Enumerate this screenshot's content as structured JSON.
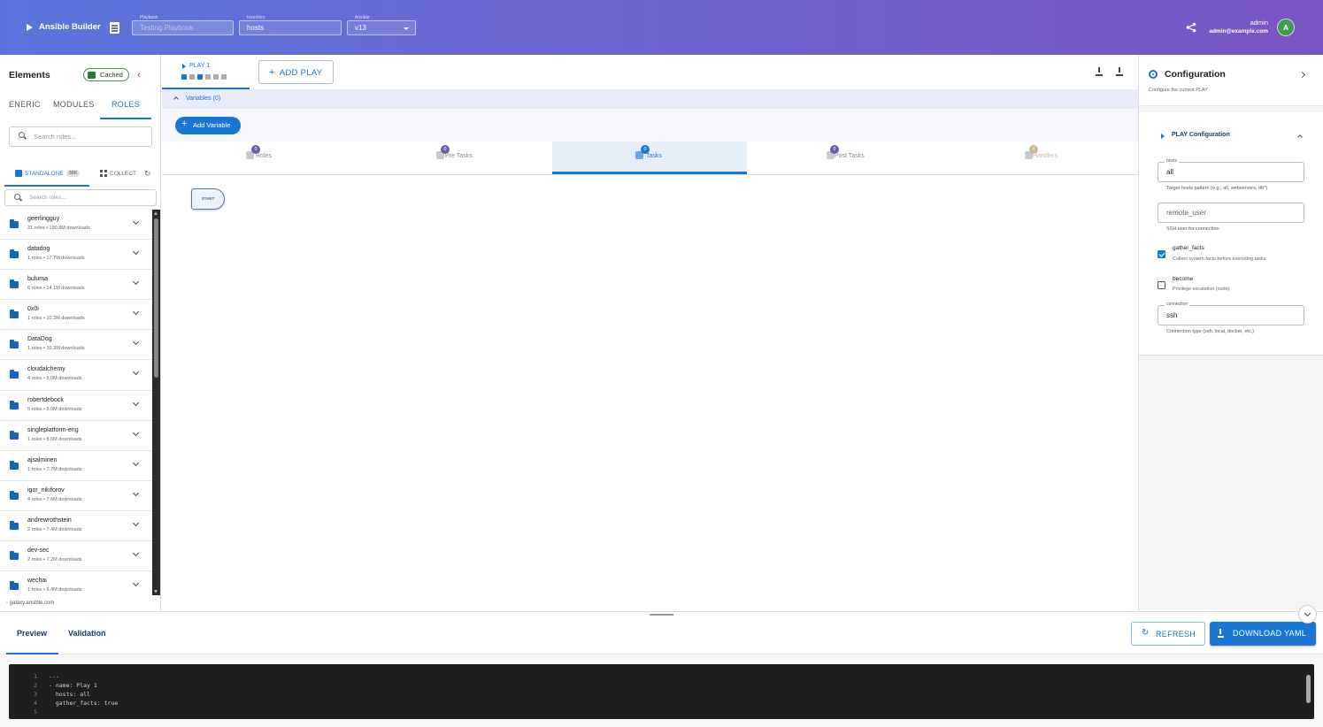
{
  "header": {
    "app_title": "Ansible Builder",
    "playbook_field": {
      "label": "Playbook",
      "value": "Testing Playbook"
    },
    "inventory_field": {
      "label": "Inventory",
      "value": "hosts"
    },
    "ansible_field": {
      "label": "Ansible",
      "value": "v13"
    },
    "user_name": "admin",
    "user_email": "admin@example.com",
    "avatar_initial": "A"
  },
  "sidebar": {
    "title": "Elements",
    "cached_label": "Cached",
    "tabs": [
      "ENERIC",
      "MODULES",
      "ROLES"
    ],
    "search_placeholder": "Search roles...",
    "subtabs": {
      "standalone": "STANDALONE",
      "standalone_badge": "38K",
      "collections": "COLLECT"
    },
    "search2_placeholder": "Search roles...",
    "roles": [
      {
        "name": "geerlingguy",
        "meta": "31 roles • 190.8M downloads"
      },
      {
        "name": "datadog",
        "meta": "1 roles • 17.7M downloads"
      },
      {
        "name": "buluma",
        "meta": "6 roles • 14.1M downloads"
      },
      {
        "name": "0x0i",
        "meta": "1 roles • 10.3M downloads"
      },
      {
        "name": "DataDog",
        "meta": "1 roles • 10.3M downloads"
      },
      {
        "name": "cloudalchemy",
        "meta": "4 roles • 8.0M downloads"
      },
      {
        "name": "robertdebock",
        "meta": "5 roles • 8.0M downloads"
      },
      {
        "name": "singleplatform-eng",
        "meta": "1 roles • 8.6M downloads"
      },
      {
        "name": "ajsalminen",
        "meta": "1 roles • 7.7M downloads"
      },
      {
        "name": "igor_nikiforov",
        "meta": "4 roles • 7.6M downloads"
      },
      {
        "name": "andrewrothstein",
        "meta": "2 roles • 7.4M downloads"
      },
      {
        "name": "dev-sec",
        "meta": "2 roles • 7.2M downloads"
      },
      {
        "name": "wechai",
        "meta": "1 roles • 6.4M downloads"
      }
    ],
    "footer": "galaxy.ansible.com"
  },
  "center": {
    "play_tab_label": "PLAY 1",
    "add_play_label": "ADD PLAY",
    "variables_label": "Variables (0)",
    "add_variable_label": "Add Variable",
    "section_tabs": [
      {
        "label": "Roles",
        "count": "0"
      },
      {
        "label": "Pre Tasks",
        "count": "0"
      },
      {
        "label": "Tasks",
        "count": "0"
      },
      {
        "label": "Post Tasks",
        "count": "0"
      },
      {
        "label": "Handlers",
        "count": "0"
      }
    ],
    "start_node_label": "START"
  },
  "config": {
    "title": "Configuration",
    "subtitle": "Configure the current PLAY",
    "section_title": "PLAY Configuration",
    "hosts_label": "hosts",
    "hosts_value": "all",
    "hosts_help": "Target hosts pattern (e.g., all, webservers, db*)",
    "remote_user_placeholder": "remote_user",
    "remote_user_help": "SSH user for connection",
    "gather_facts_label": "gather_facts",
    "gather_facts_help": "Collect system facts before executing tasks",
    "become_label": "become",
    "become_help": "Privilege escalation (sudo)",
    "connection_label": "connection",
    "connection_value": "ssh",
    "connection_help": "Connection type (ssh, local, docker, etc.)"
  },
  "bottom": {
    "tab_preview": "Preview",
    "tab_validation": "Validation",
    "refresh_label": "REFRESH",
    "download_label": "DOWNLOAD YAML",
    "code_lines": [
      {
        "n": "1",
        "text": "---"
      },
      {
        "n": "2",
        "text": "- name: Play 1"
      },
      {
        "n": "3",
        "text": "  hosts: all"
      },
      {
        "n": "4",
        "text": "  gather_facts: true"
      },
      {
        "n": "5",
        "text": ""
      }
    ]
  },
  "colors": {
    "primary": "#1976d2",
    "header_start": "#5b74dc",
    "header_end": "#7a55c2",
    "code_bg": "#1e1e1e"
  }
}
